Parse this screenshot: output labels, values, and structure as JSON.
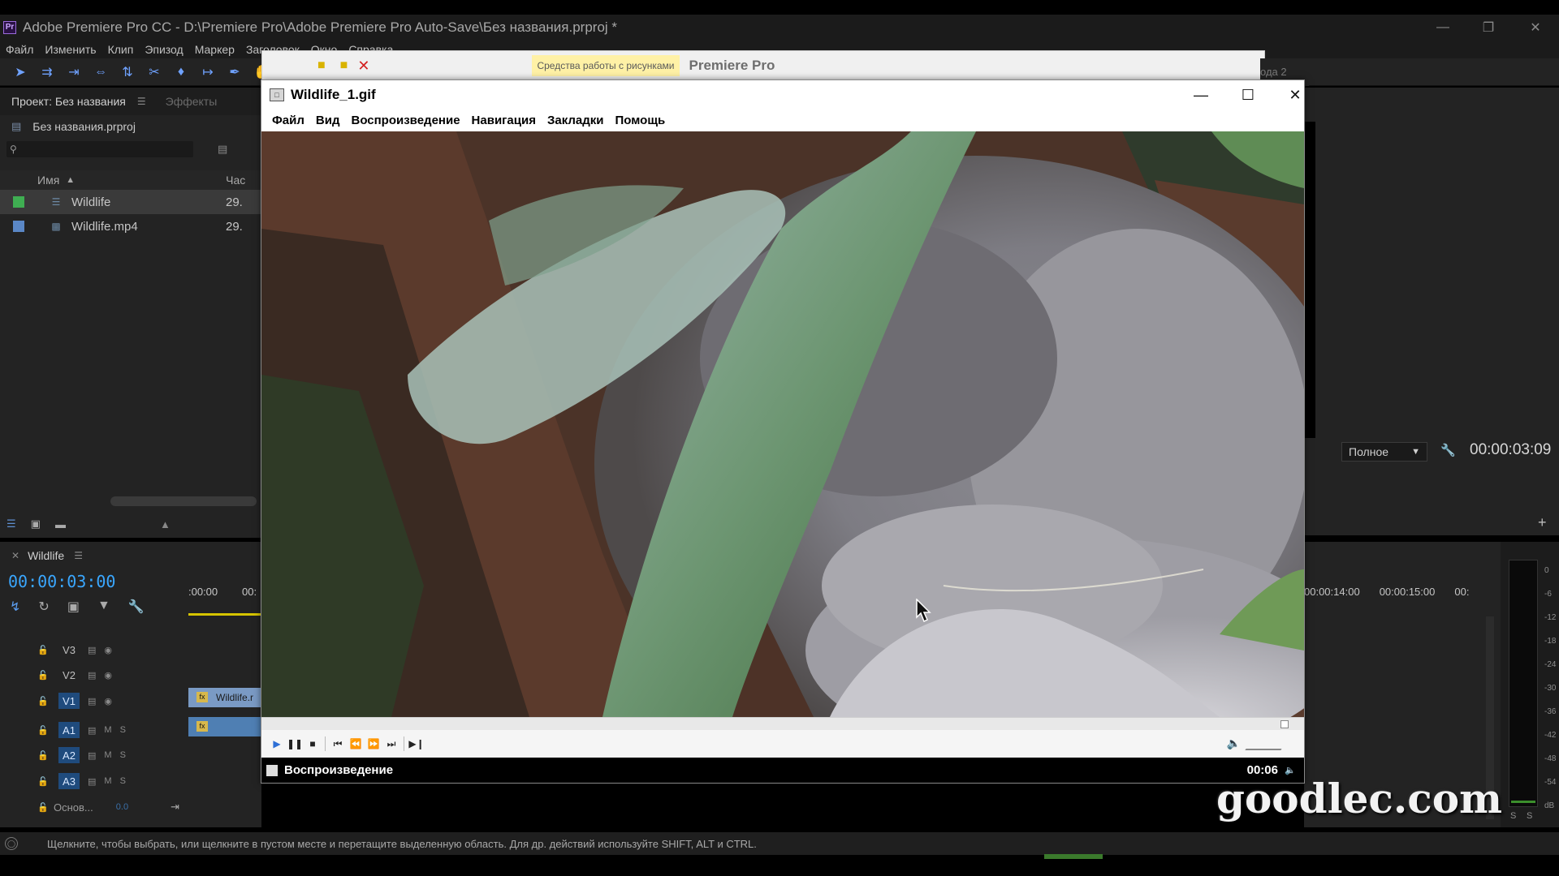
{
  "premiere": {
    "title": "Adobe Premiere Pro CC - D:\\Premiere Pro\\Adobe Premiere Pro Auto-Save\\Без названия.prproj *",
    "menu": [
      "Файл",
      "Изменить",
      "Клип",
      "Эпизод",
      "Маркер",
      "Заголовок",
      "Окно",
      "Справка"
    ],
    "project_tab": "Проект: Без названия",
    "effects_tab": "Эффекты",
    "project_file": "Без названия.prproj",
    "col_name": "Имя",
    "col_rate": "Час",
    "bins": [
      {
        "name": "Wildlife",
        "rate": "29.",
        "color": "#3fae52"
      },
      {
        "name": "Wildlife.mp4",
        "rate": "29.",
        "color": "#5a87c6"
      }
    ],
    "timeline_tab": "Wildlife",
    "timecode": "00:00:03:00",
    "ruler_left": [
      ":00:00",
      "00:"
    ],
    "tracks": [
      "V3",
      "V2",
      "V1",
      "A1",
      "A2",
      "A3"
    ],
    "track_mute": "M",
    "track_solo": "S",
    "master_track": "Основ...",
    "master_value": "0.0",
    "clip_video_label": "Wildlife.r",
    "zoom_level": "Полное",
    "program_time": "00:00:03:09",
    "ruler_right": [
      "00:00:14:00",
      "00:00:15:00",
      "00:"
    ],
    "meter_labels": [
      "0",
      "-6",
      "-12",
      "-18",
      "-24",
      "-30",
      "-36",
      "-42",
      "-48",
      "-54",
      "dB"
    ],
    "meter_bottom": [
      "S",
      "S"
    ],
    "status_text": "Щелкните, чтобы выбрать, или щелкните в пустом месте и перетащите выделенную область. Для др. действий используйте SHIFT, ALT и CTRL.",
    "bg_tab_yellow": "Средства работы с рисунками",
    "bg_tab_title": "Premiere Pro",
    "bg_right_label": "ода 2"
  },
  "viewer": {
    "title": "Wildlife_1.gif",
    "menu": [
      "Файл",
      "Вид",
      "Воспроизведение",
      "Навигация",
      "Закладки",
      "Помощь"
    ],
    "status_label": "Воспроизведение",
    "duration": "00:06",
    "progress": 0.99
  },
  "watermark": "goodlec.com"
}
